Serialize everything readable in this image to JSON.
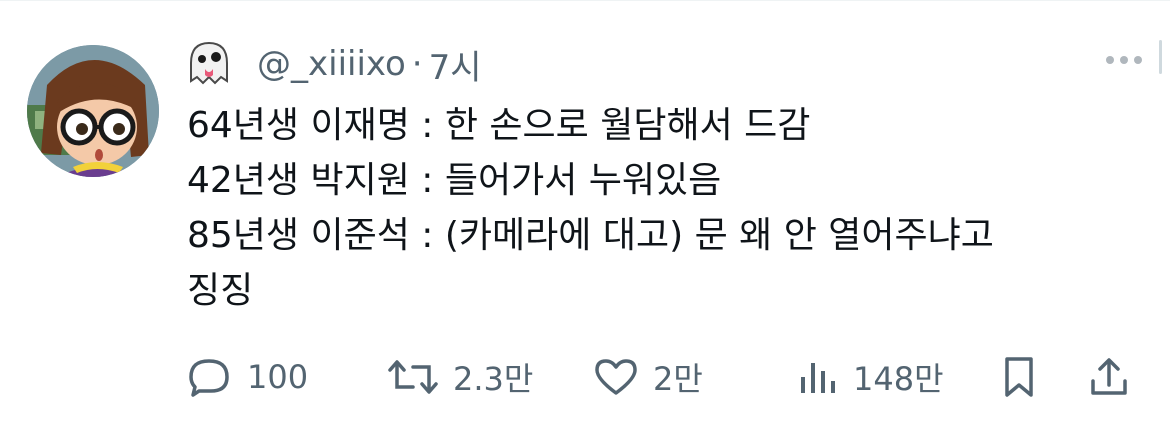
{
  "tweet": {
    "emoji": "👻",
    "handle": "@_xiiiixo",
    "separator": "·",
    "time": "7시",
    "lines": [
      "64년생 이재명 : 한 손으로 월담해서 드감",
      "42년생 박지원 : 들어가서 누워있음",
      "85년생 이준석 : (카메라에 대고) 문 왜 안 열어주냐고",
      "징징"
    ]
  },
  "actions": {
    "reply": {
      "count": "100",
      "icon": "reply-icon"
    },
    "retweet": {
      "count": "2.3만",
      "icon": "retweet-icon"
    },
    "like": {
      "count": "2만",
      "icon": "heart-icon"
    },
    "views": {
      "count": "148만",
      "icon": "views-icon"
    },
    "bookmark": {
      "icon": "bookmark-icon"
    },
    "share": {
      "icon": "share-icon"
    }
  },
  "colors": {
    "text": "#0f1419",
    "muted": "#536471",
    "divider": "#eff3f4"
  }
}
